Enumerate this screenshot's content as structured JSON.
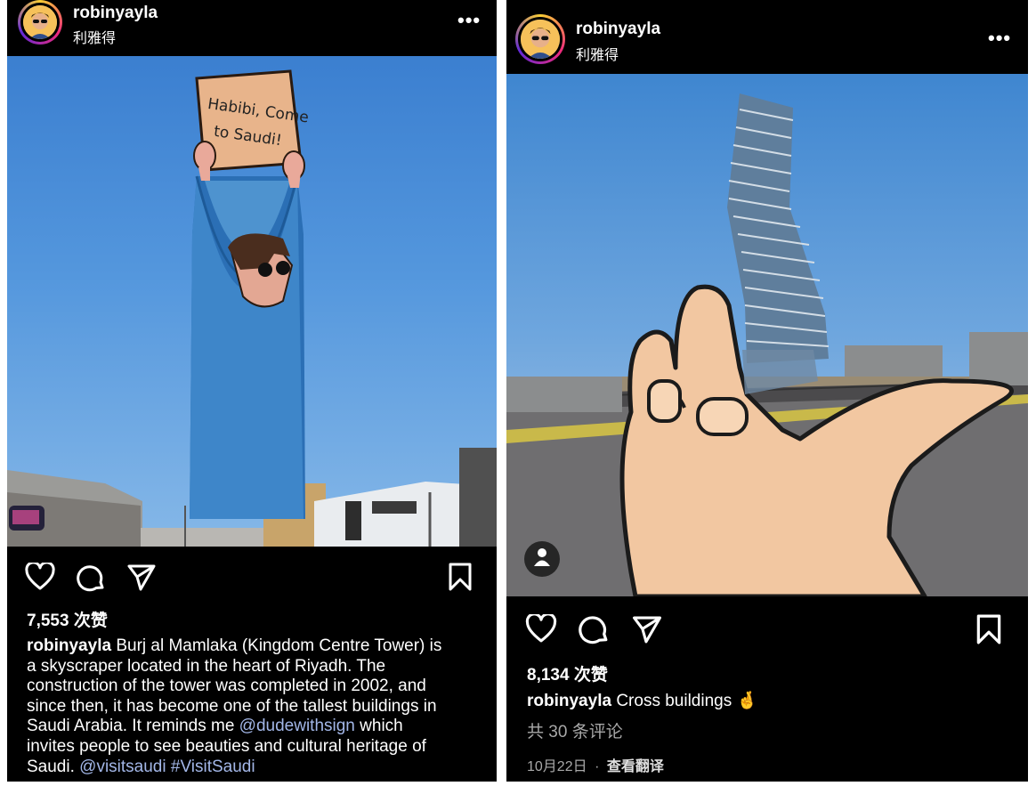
{
  "posts": [
    {
      "username": "robinyayla",
      "subtitle": "利雅得",
      "more": "•••",
      "sign_line1": "Habibi, Come",
      "sign_line2": "to Saudi!",
      "likes": "7,553 次赞",
      "caption_user": "robinyayla",
      "caption_lines": [
        "Burj al Mamlaka (Kingdom Centre Tower) is",
        "a skyscraper located in the heart of Riyadh. The",
        "construction of the tower was completed in 2002, and",
        "since then, it has become one of the tallest buildings in",
        "Saudi Arabia. It reminds me",
        "which",
        "invites people to see beauties and cultural heritage of",
        "Saudi."
      ],
      "mention_dude": "@dudewithsign",
      "mention_visit": "@visitsaudi",
      "hashtag": "#VisitSaudi"
    },
    {
      "username": "robinyayla",
      "subtitle": "利雅得",
      "more": "•••",
      "likes": "8,134 次赞",
      "caption_user": "robinyayla",
      "caption_text": "Cross buildings",
      "caption_emoji": "🤞",
      "comments": "共 30 条评论",
      "date": "10月22日",
      "dot": "·",
      "translate": "查看翻译"
    }
  ],
  "colors": {
    "background": "#000000",
    "text": "#ffffff",
    "mention": "#a3b7e8",
    "muted": "#a8a8a8"
  }
}
